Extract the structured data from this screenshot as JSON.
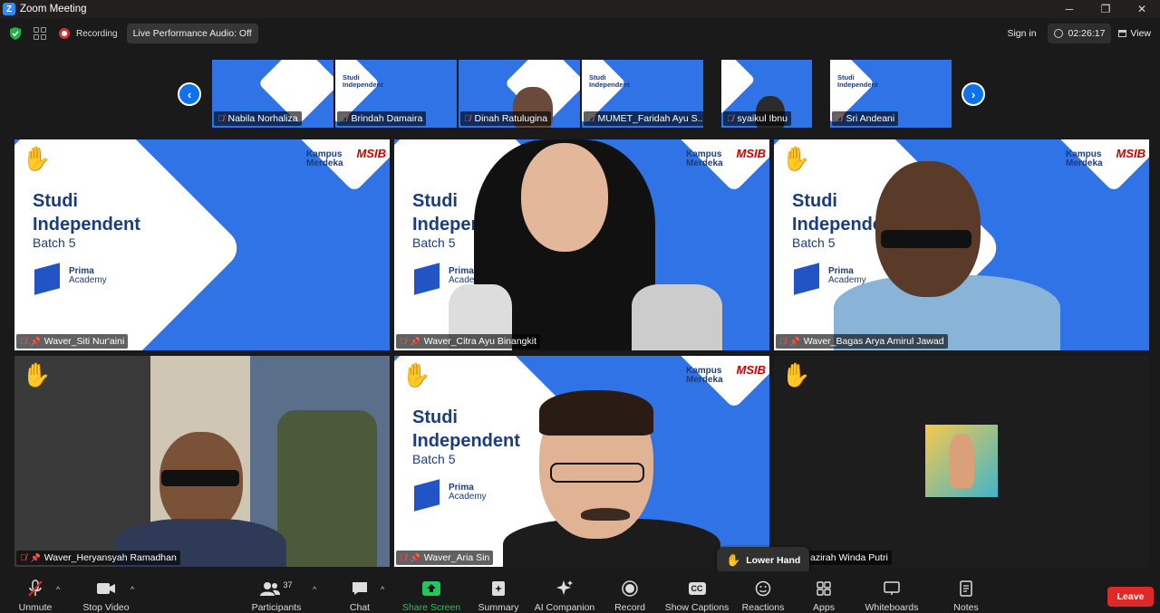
{
  "window": {
    "title": "Zoom Meeting",
    "app_icon": "zoom-logo",
    "controls": [
      "─",
      "❐",
      "✕"
    ]
  },
  "topbar": {
    "recording_label": "Recording",
    "audio_button": "Live Performance Audio: Off",
    "signin": "Sign in",
    "timer": "02:26:17",
    "view": "View"
  },
  "strip": {
    "prev": "‹",
    "next": "›",
    "participants": [
      {
        "name": "Nabila Norhaliza"
      },
      {
        "name": "Brindah Damaira"
      },
      {
        "name": "Dinah Ratulugina"
      },
      {
        "name": "MUMET_Faridah Ayu S..."
      },
      {
        "name": "syaikul Ibnu"
      },
      {
        "name": "Sri Andeani"
      }
    ]
  },
  "slide": {
    "title1": "Studi",
    "title2": "Independent",
    "batch": "Batch 5",
    "prima1": "Prima",
    "prima2": "Academy",
    "kampus1": "Kampus",
    "kampus2": "Merdeka",
    "msib": "MSIB"
  },
  "tiles": [
    {
      "name": "Waver_Siti Nur'aini",
      "hand": "✋"
    },
    {
      "name": "Waver_Citra Ayu Binangkit",
      "hand": ""
    },
    {
      "name": "Waver_Bagas Arya Amirul Jawad",
      "hand": "✋"
    },
    {
      "name": "Waver_Heryansyah Ramadhan",
      "hand": "✋"
    },
    {
      "name": "Waver_Aria Sin",
      "hand": "✋"
    },
    {
      "name": "azirah Winda Putri",
      "hand": "✋"
    }
  ],
  "lower_hand": {
    "icon": "✋",
    "label": "Lower Hand"
  },
  "toolbar": {
    "unmute": "Unmute",
    "stop_video": "Stop Video",
    "participants": "Participants",
    "participants_count": "37",
    "chat": "Chat",
    "share_screen": "Share Screen",
    "summary": "Summary",
    "ai_companion": "AI Companion",
    "record": "Record",
    "show_captions": "Show Captions",
    "captions_icon_text": "CC",
    "reactions": "Reactions",
    "apps": "Apps",
    "whiteboards": "Whiteboards",
    "notes": "Notes",
    "leave": "Leave"
  },
  "colors": {
    "accent": "#0e72ed",
    "leave": "#e02828",
    "share": "#22c55e",
    "slide_blue": "#2f73e6"
  }
}
